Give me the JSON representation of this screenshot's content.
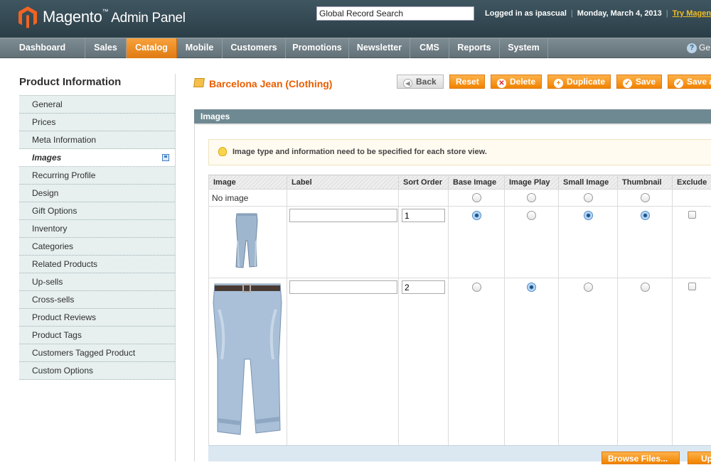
{
  "header": {
    "brand": "Magento",
    "trademark": "™",
    "subtitle": "Admin Panel",
    "search_value": "Global Record Search",
    "logged_in": "Logged in as ipascual",
    "date": "Monday, March 4, 2013",
    "try_link": "Try Magento G"
  },
  "nav": {
    "items": [
      {
        "label": "Dashboard"
      },
      {
        "label": "Sales"
      },
      {
        "label": "Catalog"
      },
      {
        "label": "Mobile"
      },
      {
        "label": "Customers"
      },
      {
        "label": "Promotions"
      },
      {
        "label": "Newsletter"
      },
      {
        "label": "CMS"
      },
      {
        "label": "Reports"
      },
      {
        "label": "System"
      }
    ],
    "active": "Catalog",
    "help_label": "Ge"
  },
  "sidebar": {
    "title": "Product Information",
    "items": [
      {
        "label": "General"
      },
      {
        "label": "Prices"
      },
      {
        "label": "Meta Information"
      },
      {
        "label": "Images"
      },
      {
        "label": "Recurring Profile"
      },
      {
        "label": "Design"
      },
      {
        "label": "Gift Options"
      },
      {
        "label": "Inventory"
      },
      {
        "label": "Categories"
      },
      {
        "label": "Related Products"
      },
      {
        "label": "Up-sells"
      },
      {
        "label": "Cross-sells"
      },
      {
        "label": "Product Reviews"
      },
      {
        "label": "Product Tags"
      },
      {
        "label": "Customers Tagged Product"
      },
      {
        "label": "Custom Options"
      }
    ],
    "active": "Images"
  },
  "page": {
    "title": "Barcelona Jean (Clothing)",
    "buttons": {
      "back": "Back",
      "reset": "Reset",
      "delete": "Delete",
      "duplicate": "Duplicate",
      "save": "Save",
      "save_continue": "Save a"
    }
  },
  "images_section": {
    "title": "Images",
    "notice": "Image type and information need to be specified for each store view.",
    "columns": [
      "Image",
      "Label",
      "Sort Order",
      "Base Image",
      "Image Play",
      "Small Image",
      "Thumbnail",
      "Exclude"
    ],
    "no_image_label": "No image",
    "rows": [
      {
        "label": "",
        "sort_order": "1",
        "base_image": true,
        "image_play": false,
        "small_image": true,
        "thumbnail": true,
        "exclude": false
      },
      {
        "label": "",
        "sort_order": "2",
        "base_image": false,
        "image_play": true,
        "small_image": false,
        "thumbnail": false,
        "exclude": false
      }
    ],
    "browse_button": "Browse Files...",
    "upload_button": "Up"
  },
  "colors": {
    "accent": "#eb5e00",
    "header_bg": "#2b3e47",
    "nav_active": "#f18200"
  }
}
